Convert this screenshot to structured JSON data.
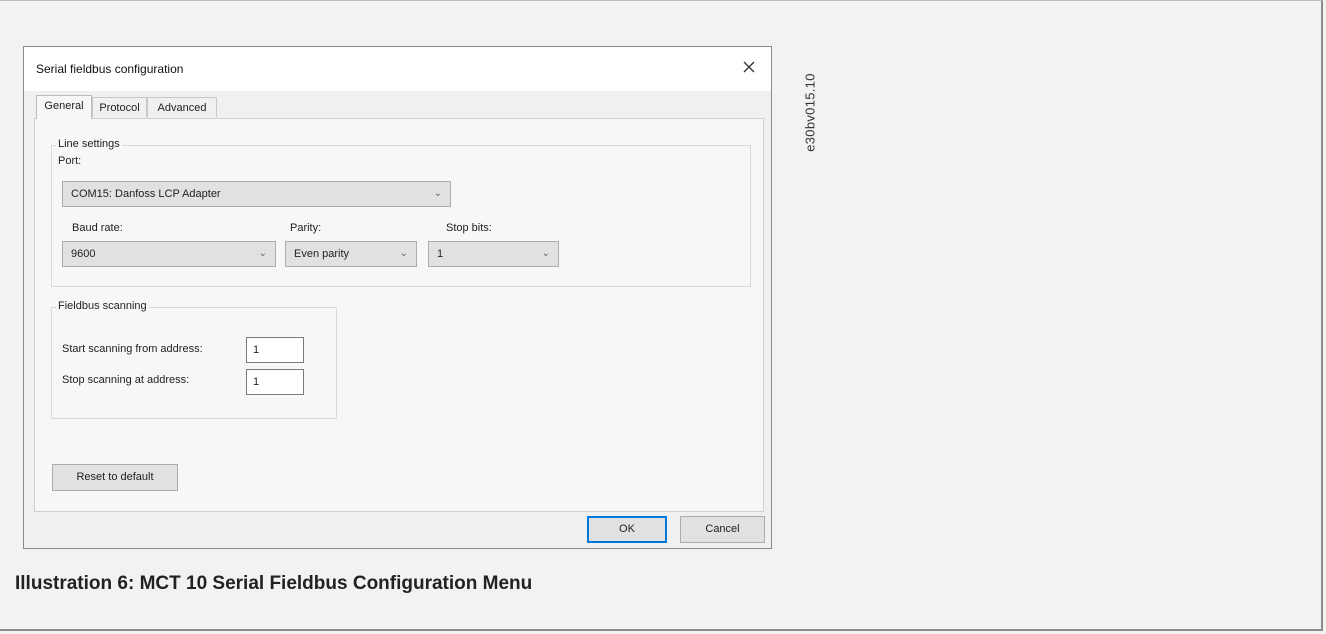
{
  "dialog": {
    "title": "Serial fieldbus configuration",
    "close_glyph": "×",
    "tabs": [
      {
        "label": "General",
        "active": true
      },
      {
        "label": "Protocol",
        "active": false
      },
      {
        "label": "Advanced",
        "active": false
      }
    ],
    "line_settings": {
      "legend": "Line settings",
      "port_label": "Port:",
      "port_value": "COM15: Danfoss LCP Adapter",
      "baud_label": "Baud rate:",
      "baud_value": "9600",
      "parity_label": "Parity:",
      "parity_value": "Even parity",
      "stop_label": "Stop bits:",
      "stop_value": "1"
    },
    "fieldbus_scanning": {
      "legend": "Fieldbus scanning",
      "start_label": "Start scanning from address:",
      "start_value": "1",
      "stop_label": "Stop scanning at address:",
      "stop_value": "1"
    },
    "reset_label": "Reset to default",
    "ok_label": "OK",
    "cancel_label": "Cancel"
  },
  "side_code": "e30bv015.10",
  "caption": "Illustration 6: MCT 10 Serial Fieldbus Configuration Menu",
  "colors": {
    "accent": "#0078d7",
    "window_bg": "#f0f0f0",
    "titlebar_bg": "#ffffff"
  }
}
